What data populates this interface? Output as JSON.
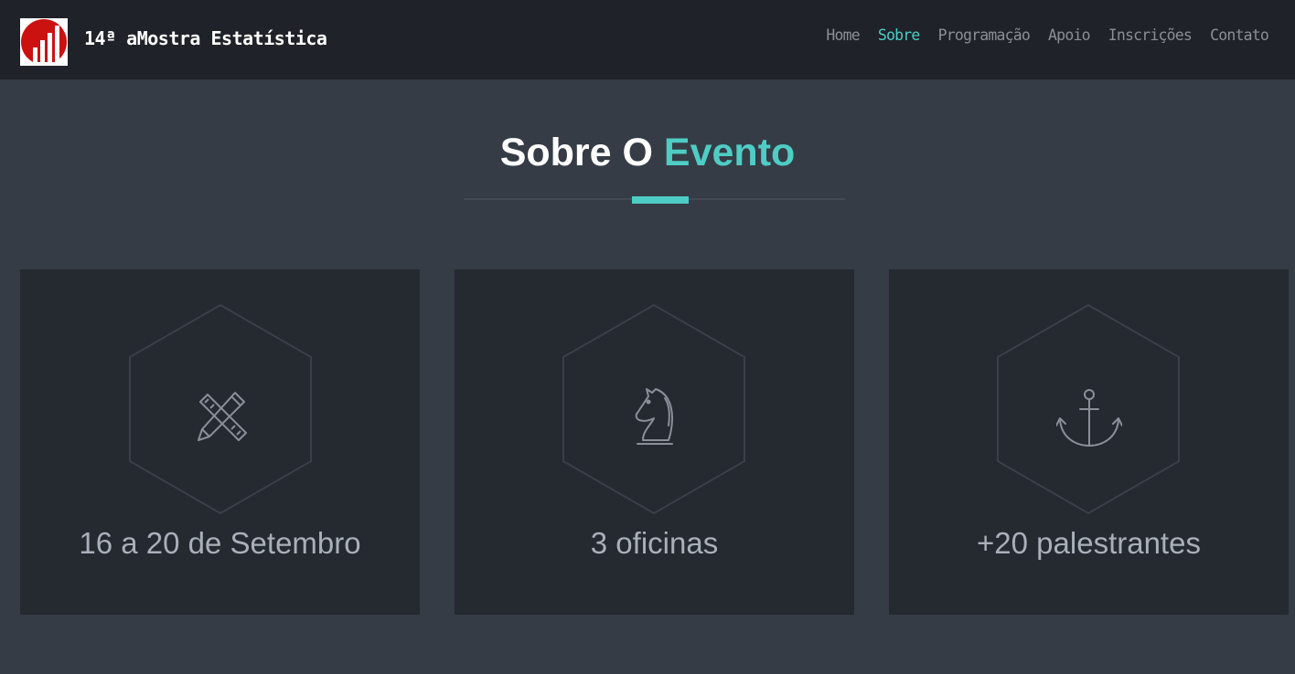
{
  "header": {
    "brand_text": "14ª aMostra Estatística",
    "logo_icon": "bar-chart-logo-icon",
    "nav": [
      {
        "label": "Home",
        "active": false
      },
      {
        "label": "Sobre",
        "active": true
      },
      {
        "label": "Programação",
        "active": false
      },
      {
        "label": "Apoio",
        "active": false
      },
      {
        "label": "Inscrições",
        "active": false
      },
      {
        "label": "Contato",
        "active": false
      }
    ]
  },
  "section": {
    "title_main": "Sobre O",
    "title_accent": "Evento"
  },
  "cards": [
    {
      "icon": "pencil-ruler-icon",
      "label": "16 a 20 de Setembro"
    },
    {
      "icon": "chess-knight-icon",
      "label": "3 oficinas"
    },
    {
      "icon": "anchor-icon",
      "label": "+20 palestrantes"
    }
  ],
  "colors": {
    "accent": "#4ecdc4",
    "navbar_bg": "#1f2228",
    "page_bg": "#363c45",
    "card_bg": "#252930",
    "logo_red": "#cc1111"
  }
}
